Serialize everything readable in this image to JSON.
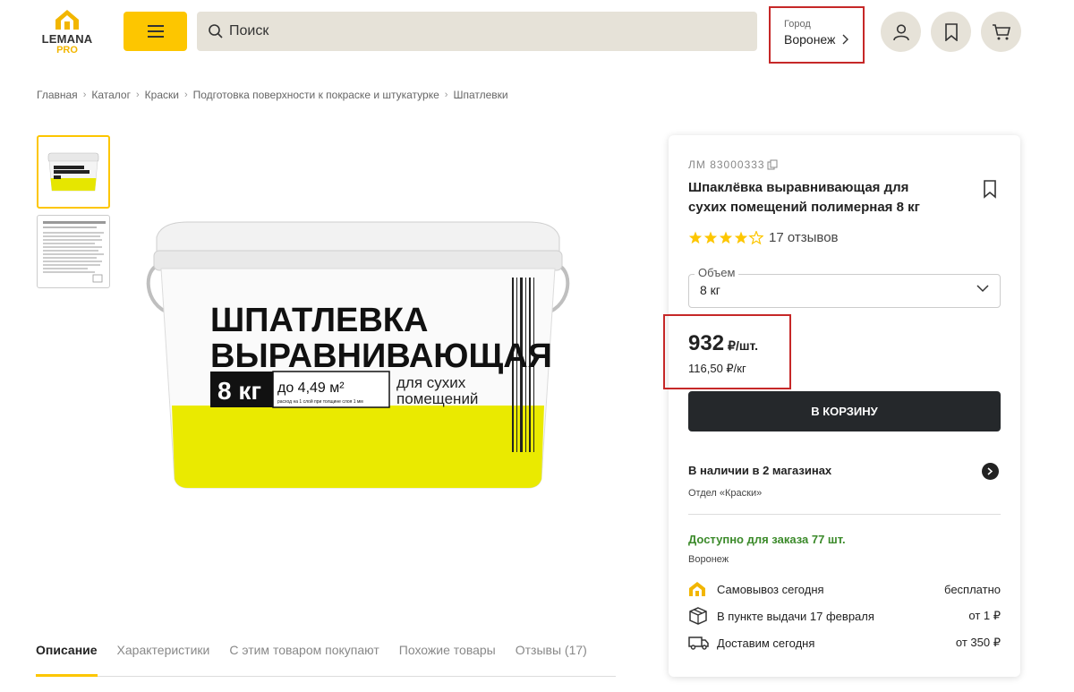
{
  "header": {
    "logo_text": "LEMANA",
    "logo_sub": "PRO",
    "search_placeholder": "Поиск",
    "city_label": "Город",
    "city_value": "Воронеж"
  },
  "breadcrumbs": [
    "Главная",
    "Каталог",
    "Краски",
    "Подготовка поверхности к покраске и штукатурке",
    "Шпатлевки"
  ],
  "product_image": {
    "line1": "ШПАТЛЕВКА",
    "line2": "ВЫРАВНИВАЮЩАЯ",
    "weight": "8 кг",
    "coverage": "до 4,49 м²",
    "coverage_note": "расход на 1 слой при толщине слоя 1 мм",
    "purpose": "для сухих помещений",
    "purpose_line1": "для сухих",
    "purpose_line2": "помещений"
  },
  "tabs": [
    "Описание",
    "Характеристики",
    "С этим товаром покупают",
    "Похожие товары",
    "Отзывы (17)"
  ],
  "card": {
    "sku": "ЛМ 83000333",
    "title": "Шпаклёвка выравнивающая для сухих помещений полимерная 8 кг",
    "rating": 4,
    "rating_max": 5,
    "reviews": "17 отзывов",
    "volume_label": "Объем",
    "volume_value": "8 кг",
    "price": "932",
    "price_unit": "₽/шт.",
    "unit_price": "116,50 ₽/кг",
    "cart_button": "В КОРЗИНУ",
    "stock_title": "В наличии в 2 магазинах",
    "stock_dept": "Отдел «Краски»",
    "available": "Доступно для заказа 77 шт.",
    "available_city": "Воронеж",
    "delivery": [
      {
        "icon": "store-house-icon",
        "label": "Самовывоз сегодня",
        "price": "бесплатно"
      },
      {
        "icon": "box-icon",
        "label": "В пункте выдачи 17 февраля",
        "price": "от 1 ₽"
      },
      {
        "icon": "truck-icon",
        "label": "Доставим сегодня",
        "price": "от 350 ₽"
      }
    ]
  },
  "colors": {
    "brand_yellow": "#fdc600",
    "dark": "#25282b",
    "highlight": "#c62828",
    "green": "#3b8a2a"
  }
}
